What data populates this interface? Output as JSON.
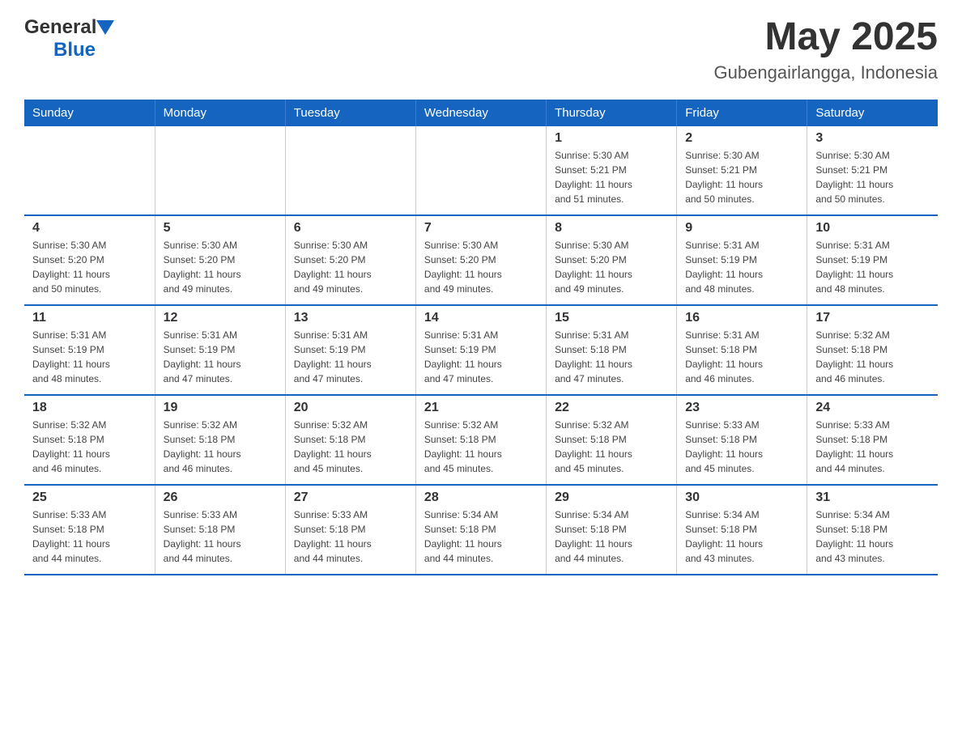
{
  "header": {
    "logo_general": "General",
    "logo_blue": "Blue",
    "month_year": "May 2025",
    "location": "Gubengairlangga, Indonesia"
  },
  "days_of_week": [
    "Sunday",
    "Monday",
    "Tuesday",
    "Wednesday",
    "Thursday",
    "Friday",
    "Saturday"
  ],
  "weeks": [
    {
      "days": [
        {
          "number": "",
          "info": ""
        },
        {
          "number": "",
          "info": ""
        },
        {
          "number": "",
          "info": ""
        },
        {
          "number": "",
          "info": ""
        },
        {
          "number": "1",
          "info": "Sunrise: 5:30 AM\nSunset: 5:21 PM\nDaylight: 11 hours\nand 51 minutes."
        },
        {
          "number": "2",
          "info": "Sunrise: 5:30 AM\nSunset: 5:21 PM\nDaylight: 11 hours\nand 50 minutes."
        },
        {
          "number": "3",
          "info": "Sunrise: 5:30 AM\nSunset: 5:21 PM\nDaylight: 11 hours\nand 50 minutes."
        }
      ]
    },
    {
      "days": [
        {
          "number": "4",
          "info": "Sunrise: 5:30 AM\nSunset: 5:20 PM\nDaylight: 11 hours\nand 50 minutes."
        },
        {
          "number": "5",
          "info": "Sunrise: 5:30 AM\nSunset: 5:20 PM\nDaylight: 11 hours\nand 49 minutes."
        },
        {
          "number": "6",
          "info": "Sunrise: 5:30 AM\nSunset: 5:20 PM\nDaylight: 11 hours\nand 49 minutes."
        },
        {
          "number": "7",
          "info": "Sunrise: 5:30 AM\nSunset: 5:20 PM\nDaylight: 11 hours\nand 49 minutes."
        },
        {
          "number": "8",
          "info": "Sunrise: 5:30 AM\nSunset: 5:20 PM\nDaylight: 11 hours\nand 49 minutes."
        },
        {
          "number": "9",
          "info": "Sunrise: 5:31 AM\nSunset: 5:19 PM\nDaylight: 11 hours\nand 48 minutes."
        },
        {
          "number": "10",
          "info": "Sunrise: 5:31 AM\nSunset: 5:19 PM\nDaylight: 11 hours\nand 48 minutes."
        }
      ]
    },
    {
      "days": [
        {
          "number": "11",
          "info": "Sunrise: 5:31 AM\nSunset: 5:19 PM\nDaylight: 11 hours\nand 48 minutes."
        },
        {
          "number": "12",
          "info": "Sunrise: 5:31 AM\nSunset: 5:19 PM\nDaylight: 11 hours\nand 47 minutes."
        },
        {
          "number": "13",
          "info": "Sunrise: 5:31 AM\nSunset: 5:19 PM\nDaylight: 11 hours\nand 47 minutes."
        },
        {
          "number": "14",
          "info": "Sunrise: 5:31 AM\nSunset: 5:19 PM\nDaylight: 11 hours\nand 47 minutes."
        },
        {
          "number": "15",
          "info": "Sunrise: 5:31 AM\nSunset: 5:18 PM\nDaylight: 11 hours\nand 47 minutes."
        },
        {
          "number": "16",
          "info": "Sunrise: 5:31 AM\nSunset: 5:18 PM\nDaylight: 11 hours\nand 46 minutes."
        },
        {
          "number": "17",
          "info": "Sunrise: 5:32 AM\nSunset: 5:18 PM\nDaylight: 11 hours\nand 46 minutes."
        }
      ]
    },
    {
      "days": [
        {
          "number": "18",
          "info": "Sunrise: 5:32 AM\nSunset: 5:18 PM\nDaylight: 11 hours\nand 46 minutes."
        },
        {
          "number": "19",
          "info": "Sunrise: 5:32 AM\nSunset: 5:18 PM\nDaylight: 11 hours\nand 46 minutes."
        },
        {
          "number": "20",
          "info": "Sunrise: 5:32 AM\nSunset: 5:18 PM\nDaylight: 11 hours\nand 45 minutes."
        },
        {
          "number": "21",
          "info": "Sunrise: 5:32 AM\nSunset: 5:18 PM\nDaylight: 11 hours\nand 45 minutes."
        },
        {
          "number": "22",
          "info": "Sunrise: 5:32 AM\nSunset: 5:18 PM\nDaylight: 11 hours\nand 45 minutes."
        },
        {
          "number": "23",
          "info": "Sunrise: 5:33 AM\nSunset: 5:18 PM\nDaylight: 11 hours\nand 45 minutes."
        },
        {
          "number": "24",
          "info": "Sunrise: 5:33 AM\nSunset: 5:18 PM\nDaylight: 11 hours\nand 44 minutes."
        }
      ]
    },
    {
      "days": [
        {
          "number": "25",
          "info": "Sunrise: 5:33 AM\nSunset: 5:18 PM\nDaylight: 11 hours\nand 44 minutes."
        },
        {
          "number": "26",
          "info": "Sunrise: 5:33 AM\nSunset: 5:18 PM\nDaylight: 11 hours\nand 44 minutes."
        },
        {
          "number": "27",
          "info": "Sunrise: 5:33 AM\nSunset: 5:18 PM\nDaylight: 11 hours\nand 44 minutes."
        },
        {
          "number": "28",
          "info": "Sunrise: 5:34 AM\nSunset: 5:18 PM\nDaylight: 11 hours\nand 44 minutes."
        },
        {
          "number": "29",
          "info": "Sunrise: 5:34 AM\nSunset: 5:18 PM\nDaylight: 11 hours\nand 44 minutes."
        },
        {
          "number": "30",
          "info": "Sunrise: 5:34 AM\nSunset: 5:18 PM\nDaylight: 11 hours\nand 43 minutes."
        },
        {
          "number": "31",
          "info": "Sunrise: 5:34 AM\nSunset: 5:18 PM\nDaylight: 11 hours\nand 43 minutes."
        }
      ]
    }
  ]
}
